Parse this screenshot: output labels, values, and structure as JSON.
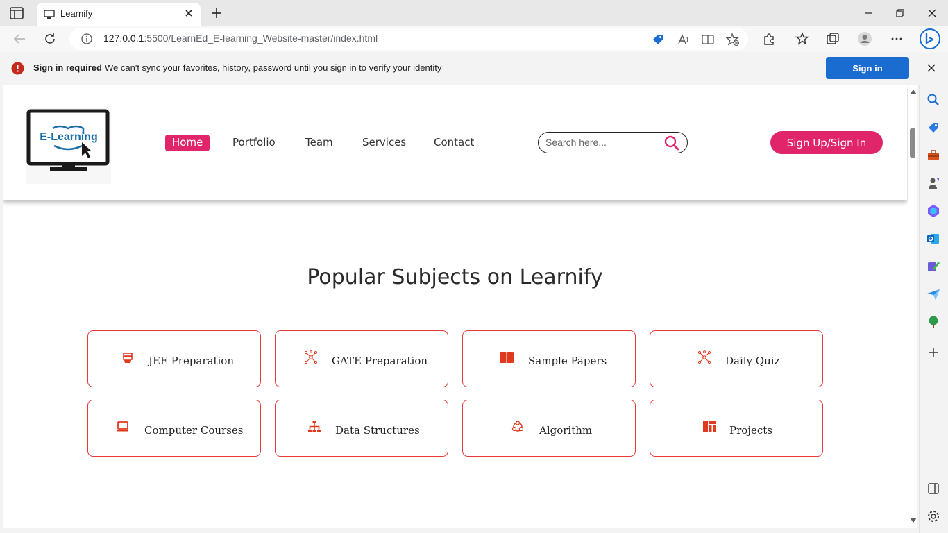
{
  "browser": {
    "tab_title": "Learnify",
    "url_host": "127.0.0.1",
    "url_rest": ":5500/LearnEd_E-learning_Website-master/index.html"
  },
  "infobar": {
    "title": "Sign in required",
    "message": "We can't sync your favorites, history, password until you sign in to verify your identity",
    "button": "Sign in"
  },
  "site": {
    "logo_text": "E-Learning",
    "nav": [
      "Home",
      "Portfolio",
      "Team",
      "Services",
      "Contact"
    ],
    "search_placeholder": "Search here...",
    "signup_label": "Sign Up/Sign In",
    "section_title": "Popular Subjects on Learnify",
    "subjects": [
      {
        "label": "JEE Preparation",
        "icon": "calculator-icon"
      },
      {
        "label": "GATE Preparation",
        "icon": "network-icon"
      },
      {
        "label": "Sample Papers",
        "icon": "book-icon"
      },
      {
        "label": "Daily Quiz",
        "icon": "network-icon"
      },
      {
        "label": "Computer Courses",
        "icon": "laptop-icon"
      },
      {
        "label": "Data Structures",
        "icon": "sitemap-icon"
      },
      {
        "label": "Algorithm",
        "icon": "cycle-icon"
      },
      {
        "label": "Projects",
        "icon": "dashboard-icon"
      }
    ]
  },
  "colors": {
    "accent": "#e0256b",
    "card_border": "#e63a3a",
    "icon_red": "#e03a1e",
    "edge_blue": "#1a6cd0"
  }
}
